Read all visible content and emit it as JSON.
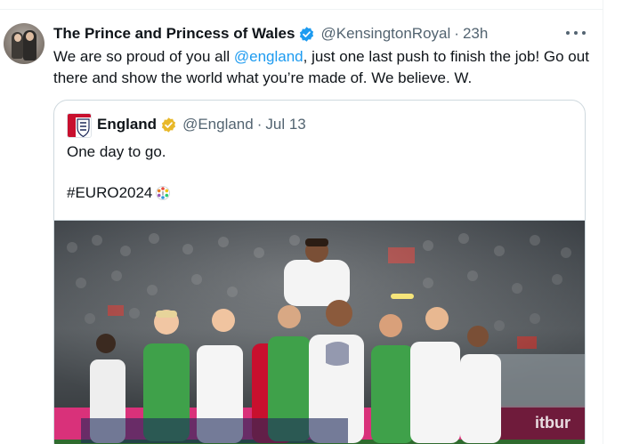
{
  "tweet": {
    "author_name": "The Prince and Princess of Wales",
    "author_handle": "@KensingtonRoyal",
    "separator": "·",
    "time": "23h",
    "text_before_mention": "We are so proud of you all ",
    "mention": "@england",
    "text_after_mention": ", just one last push to finish the job! Go out there and show the world what you’re made of. We believe. W.",
    "verified_color": "#1d9bf0",
    "mention_color": "#1d9bf0"
  },
  "quote": {
    "author_name": "England",
    "author_handle": "@England",
    "separator": "·",
    "date": "Jul 13",
    "line1": "One day to go.",
    "hashtag": "#EURO2024",
    "badge_color": "#e8b829",
    "photo_icon": "football-celebration-photo"
  },
  "icons": {
    "verified": "blue-check-icon",
    "affiliate": "gold-check-icon",
    "more": "more-dots-icon",
    "hashflag": "euro2024-trophy-icon"
  }
}
